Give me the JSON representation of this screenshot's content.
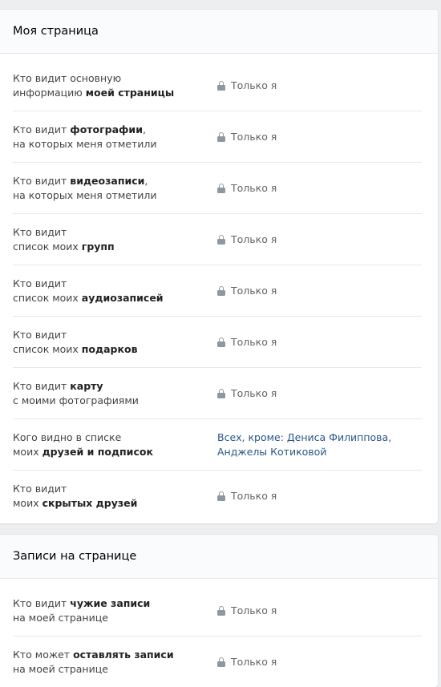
{
  "sections": [
    {
      "title": "Моя страница",
      "rows": [
        {
          "label_parts": [
            [
              "Кто видит основную",
              ""
            ],
            [
              "информацию ",
              "моей страницы"
            ]
          ],
          "value": "Только я",
          "locked": true
        },
        {
          "label_parts": [
            [
              "Кто видит ",
              "фотографии",
              ","
            ],
            [
              "на которых меня отметили",
              ""
            ]
          ],
          "value": "Только я",
          "locked": true
        },
        {
          "label_parts": [
            [
              "Кто видит ",
              "видеозаписи",
              ","
            ],
            [
              "на которых меня отметили",
              ""
            ]
          ],
          "value": "Только я",
          "locked": true
        },
        {
          "label_parts": [
            [
              "Кто видит",
              ""
            ],
            [
              "список моих ",
              "групп"
            ]
          ],
          "value": "Только я",
          "locked": true
        },
        {
          "label_parts": [
            [
              "Кто видит",
              ""
            ],
            [
              "список моих ",
              "аудиозаписей"
            ]
          ],
          "value": "Только я",
          "locked": true
        },
        {
          "label_parts": [
            [
              "Кто видит",
              ""
            ],
            [
              "список моих ",
              "подарков"
            ]
          ],
          "value": "Только я",
          "locked": true
        },
        {
          "label_parts": [
            [
              "Кто видит ",
              "карту"
            ],
            [
              "с моими фотографиями",
              ""
            ]
          ],
          "value": "Только я",
          "locked": true
        },
        {
          "label_parts": [
            [
              "Кого видно в списке",
              ""
            ],
            [
              "моих ",
              "друзей и подписок"
            ]
          ],
          "value_lines": [
            "Всех, кроме: Дениса Филиппова,",
            "Анджелы Котиковой"
          ],
          "locked": false
        },
        {
          "label_parts": [
            [
              "Кто видит",
              ""
            ],
            [
              "моих ",
              "скрытых друзей"
            ]
          ],
          "value": "Только я",
          "locked": true
        }
      ]
    },
    {
      "title": "Записи на странице",
      "rows": [
        {
          "label_parts": [
            [
              "Кто видит ",
              "чужие записи"
            ],
            [
              "на моей странице",
              ""
            ]
          ],
          "value": "Только я",
          "locked": true
        },
        {
          "label_parts": [
            [
              "Кто может ",
              "оставлять записи"
            ],
            [
              "на моей странице",
              ""
            ]
          ],
          "value": "Только я",
          "locked": true
        }
      ]
    }
  ],
  "colors": {
    "background": "#edeef0",
    "link": "#2a5885",
    "muted_text": "#656565",
    "lock_icon": "#8f97a3"
  },
  "icons": {
    "locked_value": "lock-icon"
  }
}
